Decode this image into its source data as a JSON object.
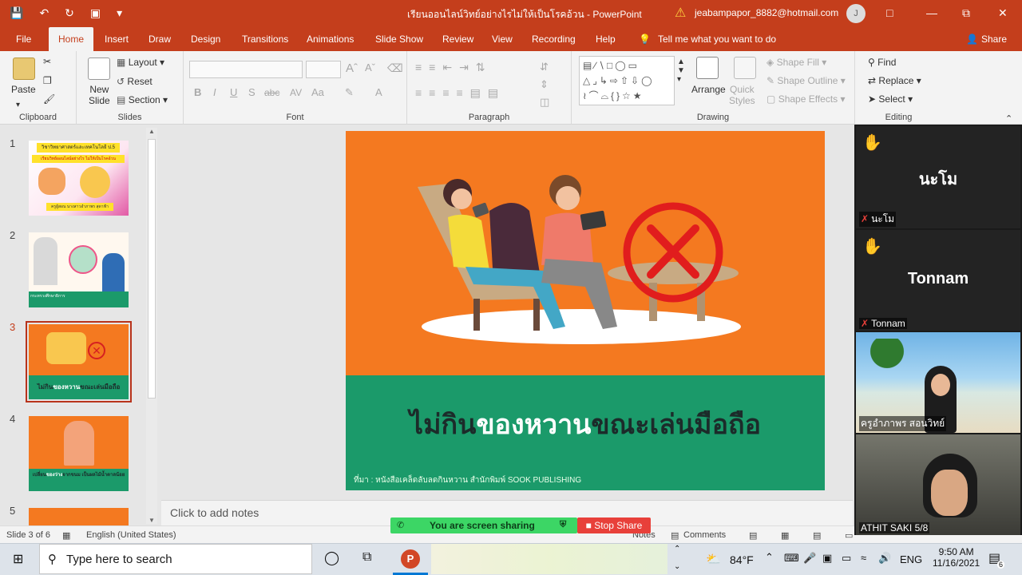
{
  "titlebar": {
    "document": "เรียนออนไลน์วิทย์อย่างไรไม่ให้เป็นโรคอ้วน  -  PowerPoint",
    "account": "jeabampapor_8882@hotmail.com",
    "avatar": "J"
  },
  "ribbon_tabs": [
    "File",
    "Home",
    "Insert",
    "Draw",
    "Design",
    "Transitions",
    "Animations",
    "Slide Show",
    "Review",
    "View",
    "Recording",
    "Help"
  ],
  "active_tab": "Home",
  "tell_me": "Tell me what you want to do",
  "share": "Share",
  "groups": {
    "clipboard": "Clipboard",
    "slides": "Slides",
    "font": "Font",
    "paragraph": "Paragraph",
    "drawing": "Drawing",
    "editing": "Editing"
  },
  "commands": {
    "paste": "Paste",
    "new_slide": "New\nSlide",
    "layout": "Layout",
    "reset": "Reset",
    "section": "Section",
    "arrange": "Arrange",
    "quick_styles": "Quick\nStyles",
    "shape_fill": "Shape Fill",
    "shape_outline": "Shape Outline",
    "shape_effects": "Shape Effects",
    "find": "Find",
    "replace": "Replace",
    "select": "Select"
  },
  "font_buttons": [
    "B",
    "I",
    "U",
    "S",
    "abc",
    "AV",
    "Aa"
  ],
  "thumbnails": [
    {
      "num": "1",
      "title": "วิชาวิทยาศาสตร์และเทคโนโลยี ป.5",
      "sub": "เรียนวิทย์ออนไลน์อย่างไร ไม่ให้เป็นโรคอ้วน",
      "author": "ครูผู้สอน นางสาวอำภาพร สุดาฟ้า"
    },
    {
      "num": "2",
      "caption": "กระทรวงศึกษาธิการ"
    },
    {
      "num": "3",
      "caption_a": "ไม่กิน",
      "caption_b": "ของหวาน",
      "caption_c": "ขณะเล่นมือถือ"
    },
    {
      "num": "4",
      "caption_a": "เปลี่ยน",
      "caption_b": "ของว่าง",
      "caption_c": "จากขนม เป็นผลไม้น้ำตาลน้อย"
    },
    {
      "num": "5"
    }
  ],
  "selected_slide": "3",
  "slide": {
    "title_a": "ไม่กิน",
    "title_b": "ของหวาน",
    "title_c": "ขณะเล่นมือถือ",
    "source": "ที่มา : หนังสือเคล็ดลับลดกินหวาน สำนักพิมพ์ SOOK PUBLISHING"
  },
  "notes_placeholder": "Click to add notes",
  "status": {
    "slide": "Slide 3 of 6",
    "lang": "English (United States)",
    "notes": "Notes",
    "comments": "Comments"
  },
  "screenshare": {
    "text": "You are screen sharing",
    "stop": "Stop Share"
  },
  "participants": [
    {
      "name": "นะโม",
      "display": "นะโม",
      "raised_hand": true,
      "muted": true
    },
    {
      "name": "Tonnam",
      "display": "Tonnam",
      "raised_hand": true,
      "muted": true
    },
    {
      "name": "ครูอำภาพร สอนวิทย์",
      "video": true
    },
    {
      "name": "ATHIT SAKI 5/8",
      "video": true
    }
  ],
  "taskbar": {
    "search_placeholder": "Type here to search",
    "temp": "84°F",
    "lang": "ENG",
    "time": "9:50 AM",
    "date": "11/16/2021",
    "notif": "6"
  },
  "colors": {
    "accent": "#c43e1c",
    "slide_orange": "#f47920",
    "slide_green": "#1b9a6a",
    "share_green": "#3cd665",
    "stop_red": "#e8403a"
  }
}
